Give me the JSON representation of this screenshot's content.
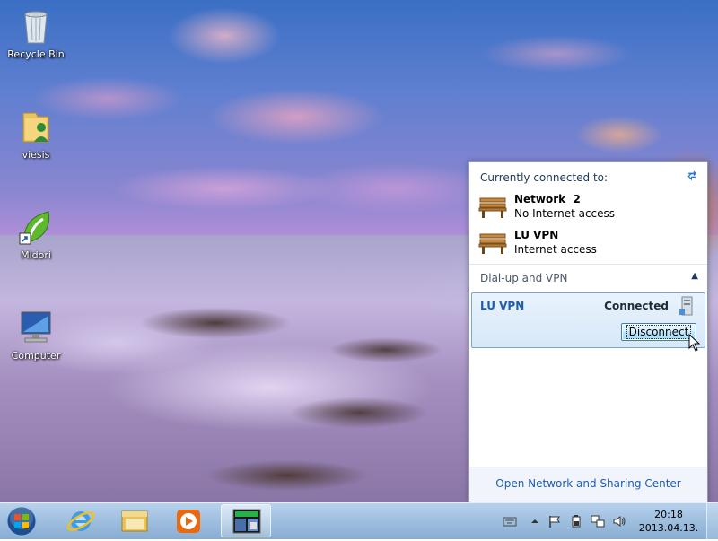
{
  "desktop": {
    "icons": [
      {
        "label": "Recycle Bin",
        "icon": "recycle-bin-icon"
      },
      {
        "label": "viesis",
        "icon": "user-folder-icon"
      },
      {
        "label": "Midori",
        "icon": "midori-icon"
      },
      {
        "label": "Computer",
        "icon": "computer-icon"
      }
    ]
  },
  "network_flyout": {
    "title": "Currently connected to:",
    "refresh_icon": "refresh-arrows-icon",
    "connections": [
      {
        "name": "Network  2",
        "status": "No Internet access",
        "icon": "bench-icon"
      },
      {
        "name": "LU VPN",
        "status": "Internet access",
        "icon": "bench-icon"
      }
    ],
    "section": {
      "label": "Dial-up and VPN",
      "chevron": "▲"
    },
    "vpn": {
      "name": "LU VPN",
      "status": "Connected",
      "icon": "vpn-server-icon",
      "button_label": "Disconnect"
    },
    "footer_link": "Open Network and Sharing Center"
  },
  "taskbar": {
    "start_icon": "windows-start-orb-icon",
    "pinned": [
      "internet-explorer-icon",
      "windows-explorer-icon",
      "media-player-icon",
      "network-app-icon"
    ],
    "tray_icons": [
      "keyboard-icon",
      "show-hidden-icons-icon",
      "flag-icon",
      "power-icon",
      "network-icon",
      "volume-icon"
    ],
    "clock": {
      "time": "20:18",
      "date": "2013.04.13."
    }
  }
}
